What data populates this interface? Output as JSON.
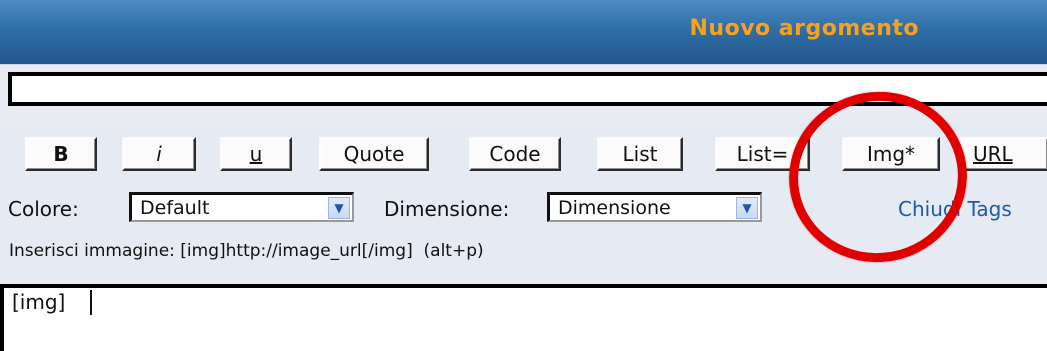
{
  "header": {
    "title": "Nuovo argomento"
  },
  "subject": {
    "value": ""
  },
  "toolbar": {
    "buttons": [
      {
        "label": "B"
      },
      {
        "label": "i"
      },
      {
        "label": "u"
      },
      {
        "label": "Quote"
      },
      {
        "label": "Code"
      },
      {
        "label": "List"
      },
      {
        "label": "List="
      },
      {
        "label": "Img*"
      },
      {
        "label": "URL"
      }
    ]
  },
  "formatting": {
    "color_label": "Colore:",
    "color_value": "Default",
    "size_label": "Dimensione:",
    "size_value": "Dimensione",
    "close_tags": "Chiudi Tags"
  },
  "help_text": "Inserisci immagine: [img]http://image_url[/img]  (alt+p)",
  "editor": {
    "content": "[img]"
  },
  "annotation": {
    "color": "#e10000"
  }
}
